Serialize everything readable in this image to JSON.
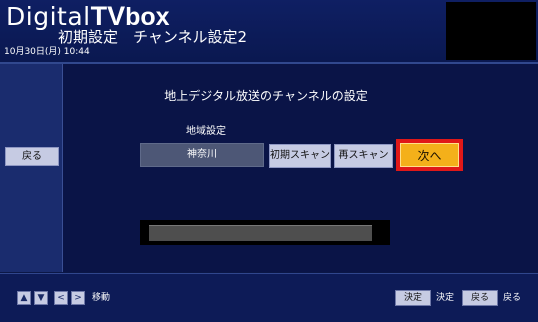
{
  "header": {
    "logo_digital": "Digital",
    "logo_tv": "TV",
    "logo_box": "box",
    "title": "初期設定　チャンネル設定2",
    "datetime": "10月30日(月)  10:44"
  },
  "left_panel": {
    "back_label": "戻る"
  },
  "main": {
    "heading": "地上デジタル放送のチャンネルの設定",
    "area_label": "地域設定",
    "area_value": "神奈川",
    "initial_scan_label": "初期スキャン",
    "rescan_label": "再スキャン",
    "next_label": "次へ",
    "progress": {
      "fraction": 0.96
    }
  },
  "footer": {
    "arrow_icons": [
      "up-arrow-icon",
      "down-arrow-icon",
      "left-arrow-icon",
      "right-arrow-icon"
    ],
    "move_label": "移動",
    "decide_key": "決定",
    "decide_label": "決定",
    "back_key": "戻る",
    "back_label": "戻る"
  },
  "colors": {
    "background": "#0b1746",
    "button": "#c6cbe3",
    "highlight_button": "#f4b01a",
    "highlight_border": "#e01818"
  }
}
